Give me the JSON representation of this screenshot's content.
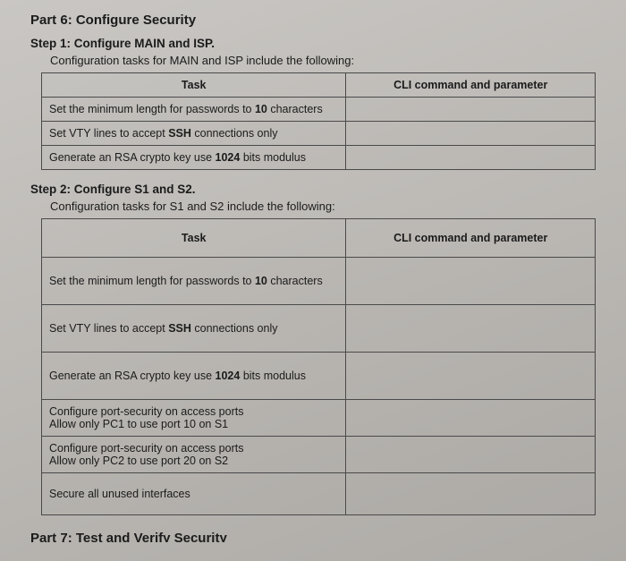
{
  "part_title": "Part 6: Configure Security",
  "step1": {
    "heading": "Step 1: Configure MAIN and ISP.",
    "desc": "Configuration tasks for MAIN and ISP include the following:",
    "headers": {
      "task": "Task",
      "cmd": "CLI command and parameter"
    },
    "rows": [
      {
        "task_pre": "Set the minimum length for passwords to ",
        "task_bold": "10",
        "task_post": " characters",
        "cmd": ""
      },
      {
        "task_pre": "Set VTY lines to accept ",
        "task_bold": "SSH",
        "task_post": " connections only",
        "cmd": ""
      },
      {
        "task_pre": "Generate an RSA crypto key use ",
        "task_bold": "1024",
        "task_post": " bits modulus",
        "cmd": ""
      }
    ]
  },
  "step2": {
    "heading": "Step 2: Configure S1 and S2.",
    "desc": "Configuration tasks for S1 and S2 include the following:",
    "headers": {
      "task": "Task",
      "cmd": "CLI command and parameter"
    },
    "rows": [
      {
        "task_pre": "Set the minimum length for passwords to ",
        "task_bold": "10",
        "task_post": " characters",
        "cmd": ""
      },
      {
        "task_pre": "Set VTY lines to accept ",
        "task_bold": "SSH",
        "task_post": " connections only",
        "cmd": ""
      },
      {
        "task_pre": "Generate an RSA crypto key use ",
        "task_bold": "1024",
        "task_post": " bits modulus",
        "cmd": ""
      },
      {
        "task_line1": "Configure port-security on access ports",
        "task_line2": "Allow only PC1 to use port 10 on S1",
        "cmd": ""
      },
      {
        "task_line1": "Configure port-security on access ports",
        "task_line2": "Allow only PC2 to use port 20 on S2",
        "cmd": ""
      },
      {
        "task_pre": "Secure all unused interfaces",
        "task_bold": "",
        "task_post": "",
        "cmd": ""
      }
    ]
  },
  "part7_cut": "Part 7: Test and Verify Security"
}
